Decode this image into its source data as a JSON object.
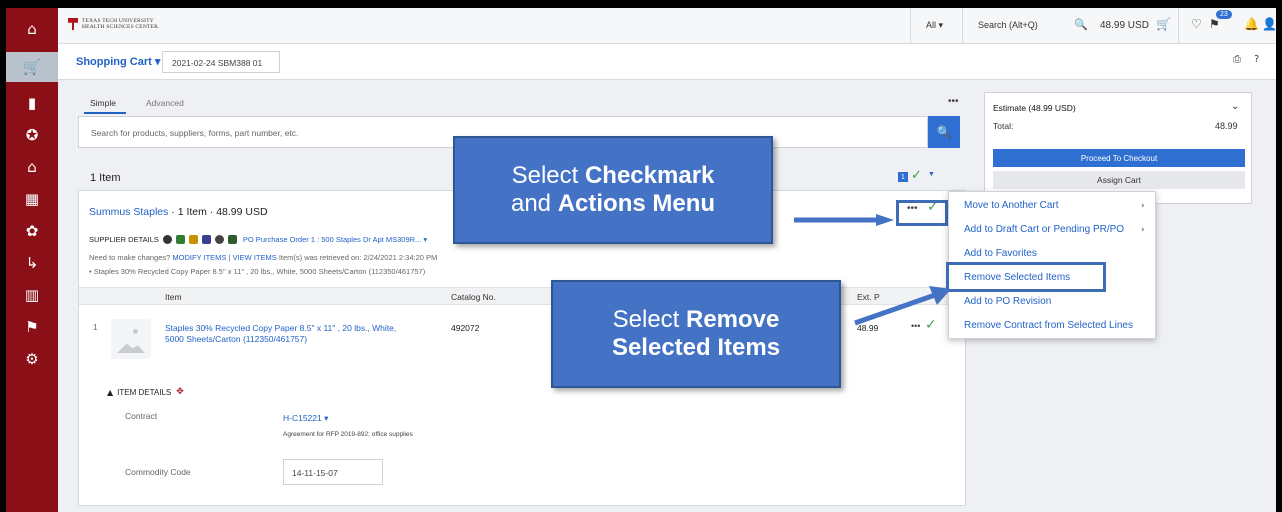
{
  "app": {
    "org_line1": "TEXAS TECH UNIVERSITY",
    "org_line2": "HEALTH SCIENCES CENTER."
  },
  "topbar": {
    "scope": "All ▾",
    "search_placeholder": "Search (Alt+Q)",
    "cart_total": "48.99 USD",
    "notification_count": "23"
  },
  "subheader": {
    "title": "Shopping Cart ▾",
    "cart_name": "2021-02-24 SBM388 01"
  },
  "search": {
    "tab_simple": "Simple",
    "tab_advanced": "Advanced",
    "more": "•••",
    "placeholder": "Search for products, suppliers, forms, part number, etc."
  },
  "estimate": {
    "title": "Estimate (48.99 USD)",
    "total_label": "Total:",
    "total_value": "48.99",
    "checkout_label": "Proceed To Checkout",
    "assign_label": "Assign Cart"
  },
  "items": {
    "count_label": "1 Item",
    "selected_count": "1"
  },
  "supplier": {
    "name": "Summus Staples",
    "meta": " · 1 Item · 48.99 USD",
    "details_label": "SUPPLIER DETAILS",
    "po_label": "PO Purchase Order 1 : 500 Staples Dr Apt MS309R... ▾",
    "changes_prefix": "Need to make changes?",
    "modify_label": "MODIFY ITEMS",
    "sep": "|",
    "view_label": "VIEW ITEMS",
    "retrieved": "Item(s) was retrieved on: 2/24/2021 2:34:20 PM",
    "summary": "•  Staples 30% Recycled Copy Paper 8.5\" x 11\" , 20 lbs., White, 5000 Sheets/Carton (112350/461757)"
  },
  "table": {
    "headers": [
      "Item",
      "Catalog No.",
      "Ext. P"
    ],
    "rows": [
      {
        "num": "1",
        "name": "Staples 30% Recycled Copy Paper 8.5\" x 11\" , 20 lbs., White, 5000 Sheets/Carton (112350/461757)",
        "catalog": "492072",
        "ext_price": "48.99"
      }
    ]
  },
  "item_details": {
    "label": "ITEM DETAILS",
    "contract_label": "Contract",
    "contract_value": "H-C15221 ▾",
    "contract_desc": "Agreement for RFP 2019-892; office supplies",
    "commodity_label": "Commodity Code",
    "commodity_value": "14-11-15-07"
  },
  "actions_menu": [
    "Move to Another Cart",
    "Add to Draft Cart or Pending PR/PO",
    "Add to Favorites",
    "Remove Selected Items",
    "Add to PO Revision",
    "Remove Contract from Selected Lines"
  ],
  "callouts": {
    "c1_pre": "Select ",
    "c1_b1": "Checkmark",
    "c1_mid": "and ",
    "c1_b2": "Actions Menu",
    "c2_pre": "Select ",
    "c2_b1": "Remove",
    "c2_b2": "Selected Items"
  },
  "colors": {
    "nav_red": "#8b0f16",
    "link_blue": "#2262c6",
    "primary_blue": "#2f6fd2",
    "callout_blue": "#4472c4",
    "check_green": "#43a047"
  }
}
